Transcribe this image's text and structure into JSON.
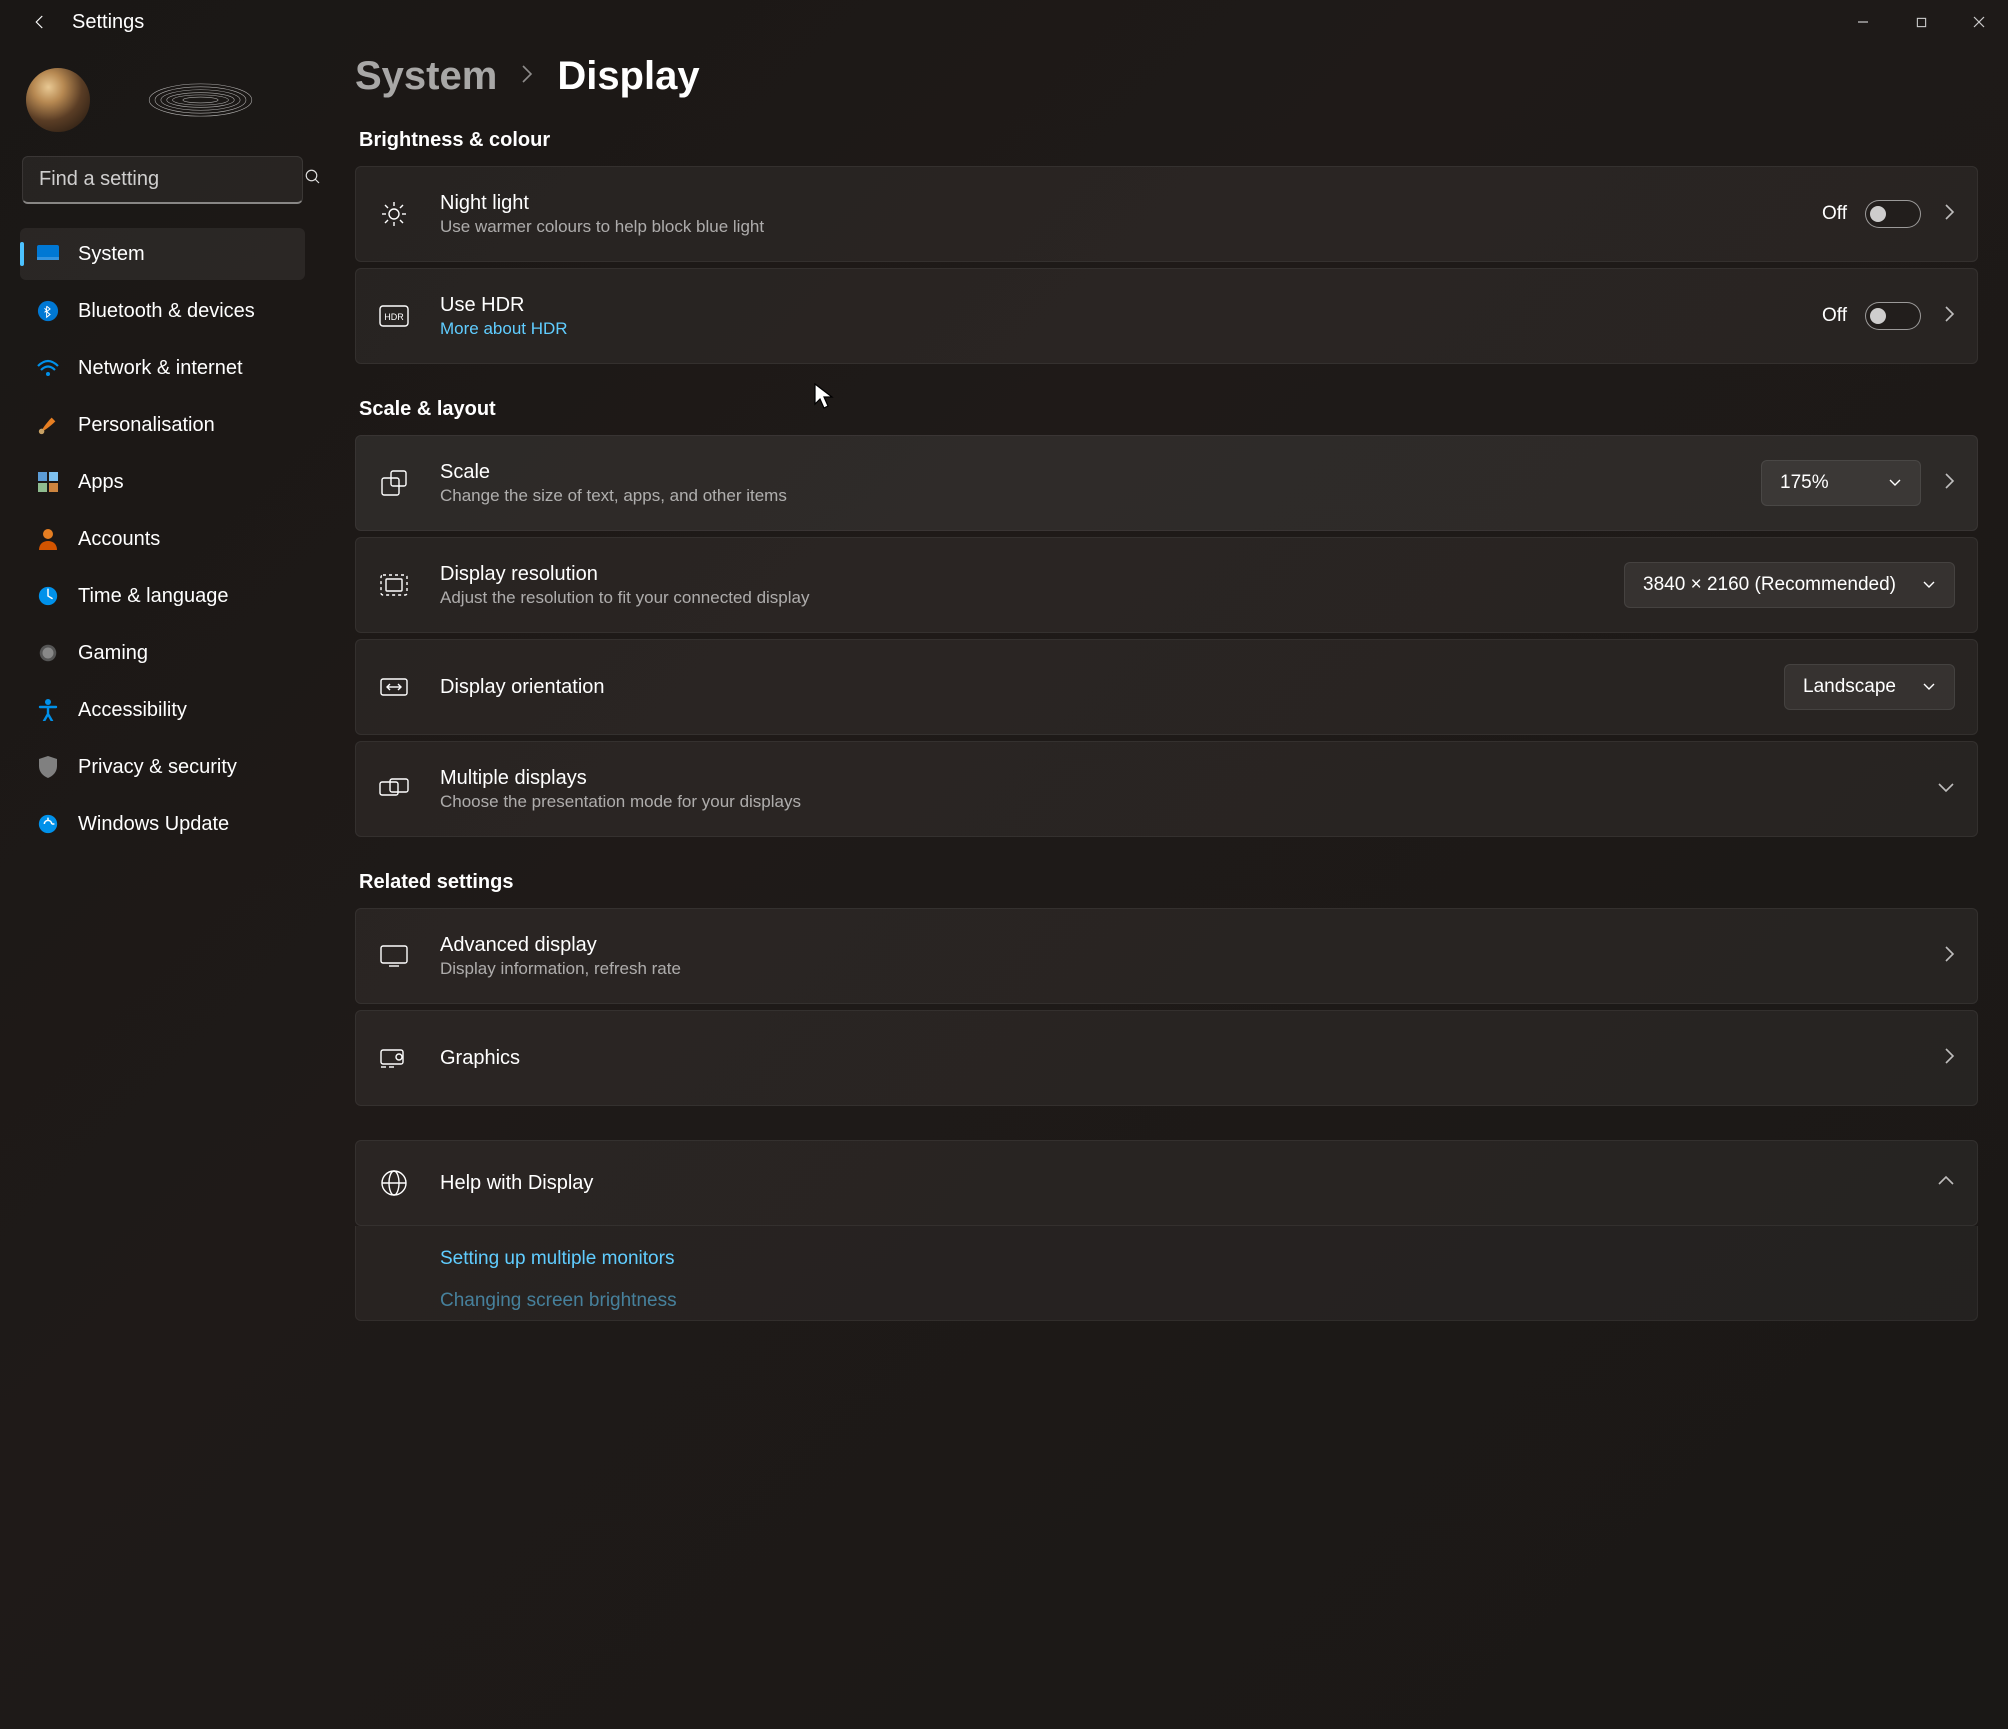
{
  "window_title": "Settings",
  "search": {
    "placeholder": "Find a setting"
  },
  "sidebar": {
    "items": [
      {
        "label": "System"
      },
      {
        "label": "Bluetooth & devices"
      },
      {
        "label": "Network & internet"
      },
      {
        "label": "Personalisation"
      },
      {
        "label": "Apps"
      },
      {
        "label": "Accounts"
      },
      {
        "label": "Time & language"
      },
      {
        "label": "Gaming"
      },
      {
        "label": "Accessibility"
      },
      {
        "label": "Privacy & security"
      },
      {
        "label": "Windows Update"
      }
    ]
  },
  "breadcrumb": {
    "parent": "System",
    "current": "Display"
  },
  "sections": {
    "brightness": {
      "heading": "Brightness & colour",
      "night_light": {
        "title": "Night light",
        "sub": "Use warmer colours to help block blue light",
        "state": "Off"
      },
      "hdr": {
        "title": "Use HDR",
        "link": "More about HDR",
        "state": "Off"
      }
    },
    "scale": {
      "heading": "Scale & layout",
      "scale_row": {
        "title": "Scale",
        "sub": "Change the size of text, apps, and other items",
        "value": "175%"
      },
      "resolution": {
        "title": "Display resolution",
        "sub": "Adjust the resolution to fit your connected display",
        "value": "3840 × 2160 (Recommended)"
      },
      "orientation": {
        "title": "Display orientation",
        "value": "Landscape"
      },
      "multi": {
        "title": "Multiple displays",
        "sub": "Choose the presentation mode for your displays"
      }
    },
    "related": {
      "heading": "Related settings",
      "advanced": {
        "title": "Advanced display",
        "sub": "Display information, refresh rate"
      },
      "graphics": {
        "title": "Graphics"
      }
    },
    "help": {
      "title": "Help with Display",
      "links": [
        "Setting up multiple monitors",
        "Changing screen brightness"
      ]
    }
  }
}
